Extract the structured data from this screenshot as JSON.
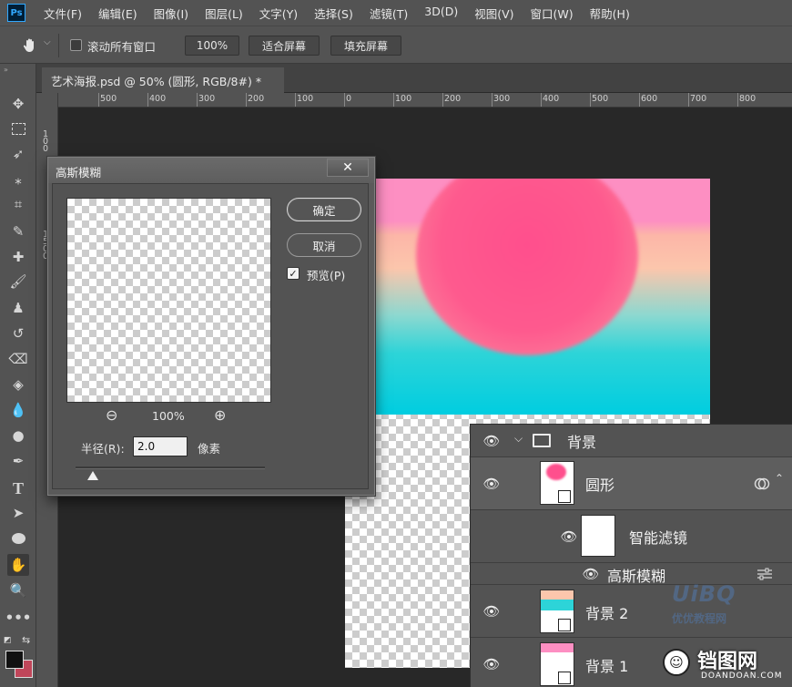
{
  "app": {
    "logo": "Ps"
  },
  "menu": [
    "文件(F)",
    "编辑(E)",
    "图像(I)",
    "图层(L)",
    "文字(Y)",
    "选择(S)",
    "滤镜(T)",
    "3D(D)",
    "视图(V)",
    "窗口(W)",
    "帮助(H)"
  ],
  "options_bar": {
    "tool_icon": "hand-icon",
    "scroll_all_windows_label": "滚动所有窗口",
    "zoom_value": "100%",
    "fit_screen_label": "适合屏幕",
    "fill_screen_label": "填充屏幕"
  },
  "document_tab": {
    "title": "艺术海报.psd @ 50% (圆形, RGB/8#) *"
  },
  "ruler_h_labels": [
    "500",
    "400",
    "300",
    "200",
    "100",
    "0",
    "100",
    "200",
    "300",
    "400",
    "500",
    "600",
    "700",
    "800"
  ],
  "ruler_v_labels": [
    "1",
    "0",
    "0",
    "1",
    "5",
    "0",
    "0"
  ],
  "dialog": {
    "title": "高斯模糊",
    "close_symbol": "✕",
    "ok_label": "确定",
    "cancel_label": "取消",
    "preview_label": "预览(P)",
    "preview_checked": true,
    "zoom_out_symbol": "⊖",
    "zoom_in_symbol": "⊕",
    "zoom_percent": "100%",
    "radius_label": "半径(R):",
    "radius_value": "2.0",
    "unit_label": "像素",
    "slider_position": 0.09
  },
  "layers": [
    {
      "id": "group",
      "name": "背景",
      "kind": "group",
      "expanded": true
    },
    {
      "id": "circle",
      "name": "圆形",
      "kind": "smart-object",
      "selected": true
    },
    {
      "id": "smart-filters",
      "name": "智能滤镜",
      "kind": "filter-mask"
    },
    {
      "id": "gaussian",
      "name": "高斯模糊",
      "kind": "filter"
    },
    {
      "id": "bg2",
      "name": "背景 2",
      "kind": "smart-object"
    },
    {
      "id": "bg1",
      "name": "背景 1",
      "kind": "smart-object"
    }
  ],
  "watermarks": {
    "site_logo": "UiBQ",
    "site_text": "优优教程网",
    "brand": "铛图网",
    "brand_url": "DOANDOAN.COM"
  },
  "colors": {
    "ui_dark": "#535353",
    "canvas_bg": "#282828",
    "pink_top": "#fd8fc2",
    "peach": "#fcc6ac",
    "cyan": "#00cde0",
    "circle": "#fe5a8e",
    "bg_color_swatch": "#c0465a"
  }
}
